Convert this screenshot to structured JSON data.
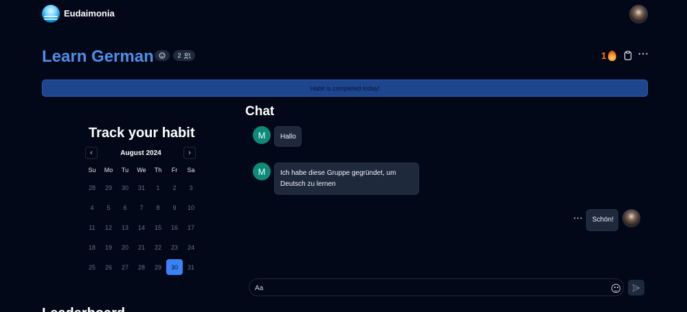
{
  "app": {
    "name": "Eudaimonia"
  },
  "habit": {
    "title": "Learn German",
    "members_count": "2",
    "streak": "1",
    "banner": "Habit is completed today!"
  },
  "calendar": {
    "title": "Track your habit",
    "month": "August 2024",
    "weekdays": [
      "Su",
      "Mo",
      "Tu",
      "We",
      "Th",
      "Fr",
      "Sa"
    ],
    "weeks": [
      [
        "28",
        "29",
        "30",
        "31",
        "1",
        "2",
        "3"
      ],
      [
        "4",
        "5",
        "6",
        "7",
        "8",
        "9",
        "10"
      ],
      [
        "11",
        "12",
        "13",
        "14",
        "15",
        "16",
        "17"
      ],
      [
        "18",
        "19",
        "20",
        "21",
        "22",
        "23",
        "24"
      ],
      [
        "25",
        "26",
        "27",
        "28",
        "29",
        "30",
        "31"
      ]
    ],
    "selected": "30"
  },
  "chat": {
    "title": "Chat",
    "messages": [
      {
        "avatar": "M",
        "text": "Hallo"
      },
      {
        "avatar": "M",
        "text": "Ich habe diese Gruppe gegründet, um Deutsch zu lernen"
      },
      {
        "text": "Schön!",
        "more": "···"
      }
    ],
    "input_placeholder": "Aa"
  },
  "footer_heading": "Leaderboard",
  "icons": {
    "logo": "eudaimonia-logo",
    "emoji_pill": "emoji-icon",
    "members": "users-icon",
    "streak": "flame-icon",
    "clipboard": "clipboard-icon",
    "more": "ellipsis-icon",
    "emoji_input": "smile-icon",
    "send": "send-icon"
  },
  "colors": {
    "background": "#020817",
    "accent": "#4f8fe8",
    "banner": "#1e468f",
    "selected_day": "#3b82f6",
    "streak": "#f97316",
    "avatar_m": "#0f8a7a"
  }
}
